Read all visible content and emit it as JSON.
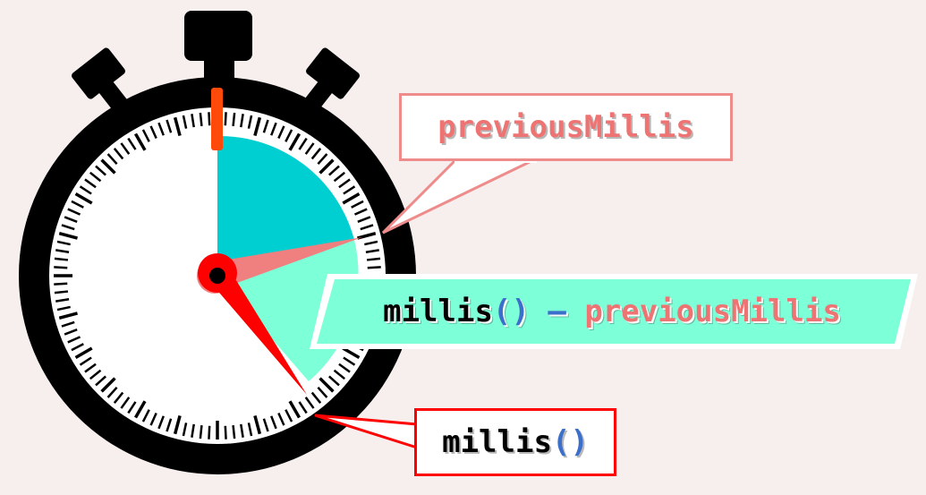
{
  "labels": {
    "previous": "previousMillis",
    "current_fn": "millis",
    "current_parens": "()",
    "diff_fn": "millis",
    "diff_parens": "()",
    "diff_op": "–",
    "diff_prev": "previousMillis"
  },
  "colors": {
    "background": "#f7eeee",
    "stopwatch_body": "#000000",
    "dial_face": "#ffffff",
    "elapsed_cyan": "#00cfd2",
    "elapsed_mint": "#7dffd8",
    "previous_hand": "#f07f80",
    "current_hand": "#ff0000",
    "start_marker": "#ff4a0a",
    "previous_text": "#ee7474",
    "paren_blue": "#3b6fc9",
    "callout_prev_border": "#ee8c8c",
    "callout_millis_border": "#ff0000"
  },
  "icons": [
    "stopwatch-icon"
  ]
}
